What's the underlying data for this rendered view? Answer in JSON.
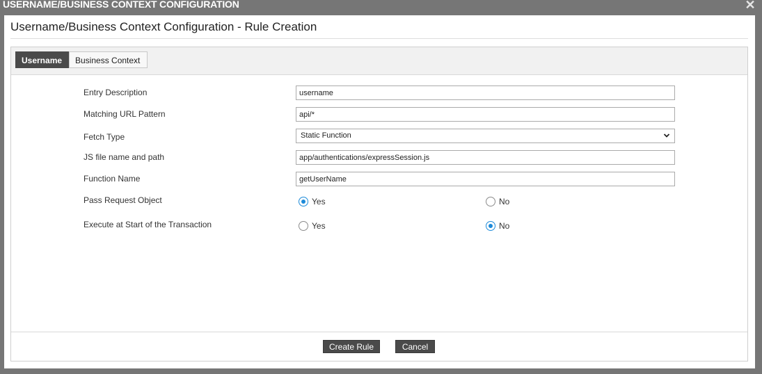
{
  "window": {
    "title": "USERNAME/BUSINESS CONTEXT CONFIGURATION",
    "close_glyph": "✕"
  },
  "dialog": {
    "heading": "Username/Business Context Configuration - Rule Creation"
  },
  "tabs": [
    {
      "label": "Username",
      "active": true
    },
    {
      "label": "Business Context",
      "active": false
    }
  ],
  "form": {
    "entry_description": {
      "label": "Entry Description",
      "value": "username"
    },
    "url_pattern": {
      "label": "Matching URL Pattern",
      "value": "api/*"
    },
    "fetch_type": {
      "label": "Fetch Type",
      "value": "Static Function"
    },
    "js_file": {
      "label": "JS file name and path",
      "value": "app/authentications/expressSession.js"
    },
    "function_name": {
      "label": "Function Name",
      "value": "getUserName"
    },
    "pass_request": {
      "label": "Pass Request Object",
      "yes": "Yes",
      "no": "No",
      "selected": "Yes"
    },
    "execute_start": {
      "label": "Execute at Start of the Transaction",
      "yes": "Yes",
      "no": "No",
      "selected": "No"
    }
  },
  "footer": {
    "create_label": "Create Rule",
    "cancel_label": "Cancel"
  },
  "colors": {
    "accent": "#1c8ad9",
    "dark_button": "#4a4a4a",
    "overlay": "#767676"
  }
}
